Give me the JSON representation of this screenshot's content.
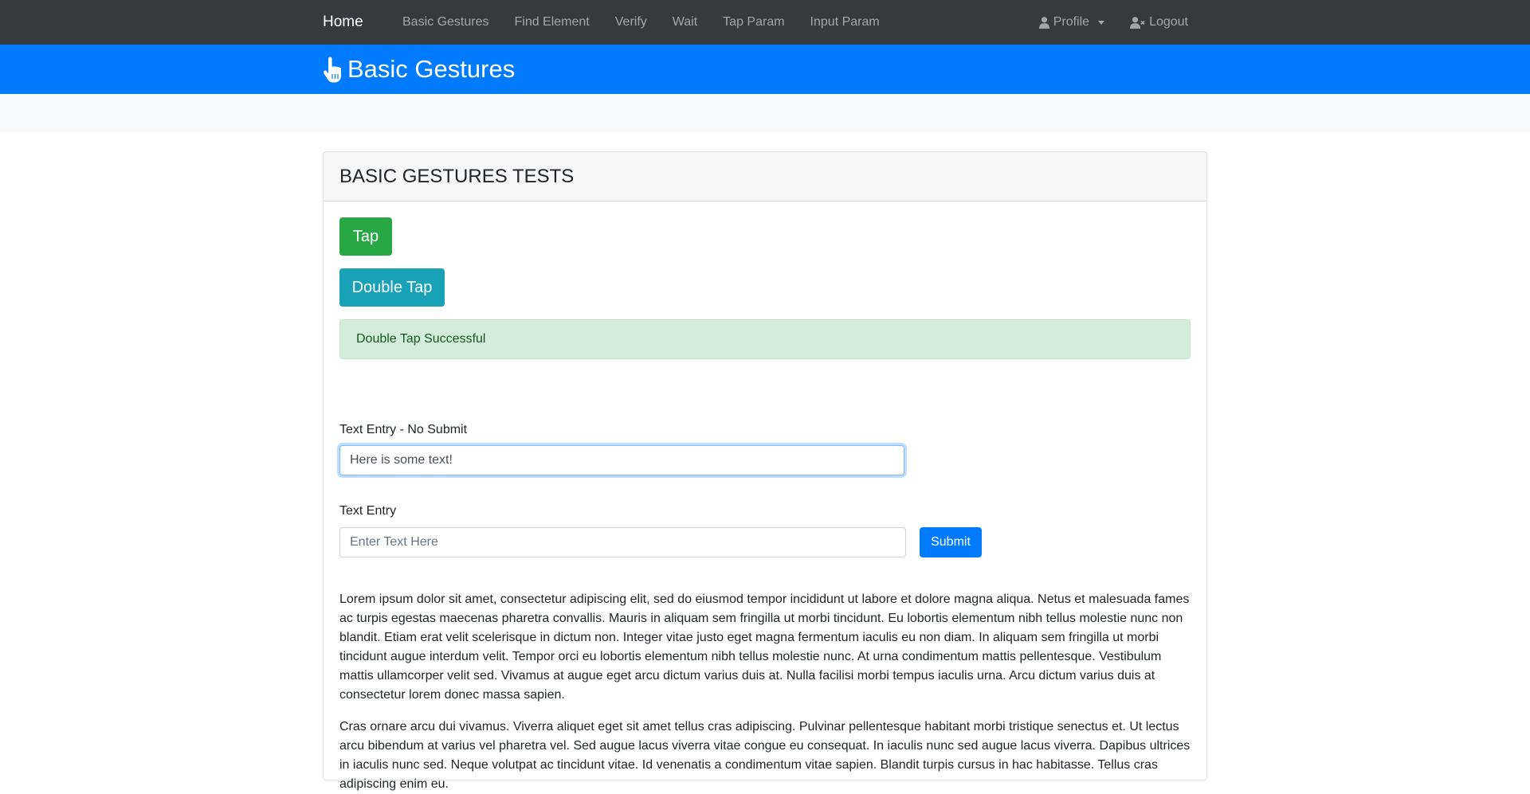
{
  "navbar": {
    "brand": "Home",
    "links": [
      "Basic Gestures",
      "Find Element",
      "Verify",
      "Wait",
      "Tap Param",
      "Input Param"
    ],
    "profile_label": "Profile",
    "logout_label": "Logout"
  },
  "header": {
    "title": "Basic Gestures"
  },
  "card": {
    "title": "BASIC GESTURES TESTS",
    "tap_label": "Tap",
    "double_tap_label": "Double Tap",
    "alert_text": "Double Tap Successful",
    "text_entry_no_submit_label": "Text Entry - No Submit",
    "text_entry_no_submit_value": "Here is some text!",
    "text_entry_label": "Text Entry",
    "text_entry_placeholder": "Enter Text Here",
    "submit_label": "Submit",
    "paragraphs": [
      "Lorem ipsum dolor sit amet, consectetur adipiscing elit, sed do eiusmod tempor incididunt ut labore et dolore magna aliqua. Netus et malesuada fames ac turpis egestas maecenas pharetra convallis. Mauris in aliquam sem fringilla ut morbi tincidunt. Eu lobortis elementum nibh tellus molestie nunc non blandit. Etiam erat velit scelerisque in dictum non. Integer vitae justo eget magna fermentum iaculis eu non diam. In aliquam sem fringilla ut morbi tincidunt augue interdum velit. Tempor orci eu lobortis elementum nibh tellus molestie nunc. At urna condimentum mattis pellentesque. Vestibulum mattis ullamcorper velit sed. Vivamus at augue eget arcu dictum varius duis at. Nulla facilisi morbi tempus iaculis urna. Arcu dictum varius duis at consectetur lorem donec massa sapien.",
      "Cras ornare arcu dui vivamus. Viverra aliquet eget sit amet tellus cras adipiscing. Pulvinar pellentesque habitant morbi tristique senectus et. Ut lectus arcu bibendum at varius vel pharetra vel. Sed augue lacus viverra vitae congue eu consequat. In iaculis nunc sed augue lacus viverra. Dapibus ultrices in iaculis nunc sed. Neque volutpat ac tincidunt vitae. Id venenatis a condimentum vitae sapien. Blandit turpis cursus in hac habitasse. Tellus cras adipiscing enim eu."
    ]
  },
  "colors": {
    "navbar_bg": "#343a40",
    "header_bg": "#007bff",
    "tap_button": "#28a745",
    "double_tap_button": "#17a2b8",
    "alert_bg": "#d4edda",
    "alert_text": "#155724",
    "submit_button": "#007bff"
  },
  "icons": {
    "header": "hand-pointer-icon",
    "profile": "user-icon",
    "logout": "user-times-icon",
    "profile_dropdown": "caret-down-icon"
  }
}
